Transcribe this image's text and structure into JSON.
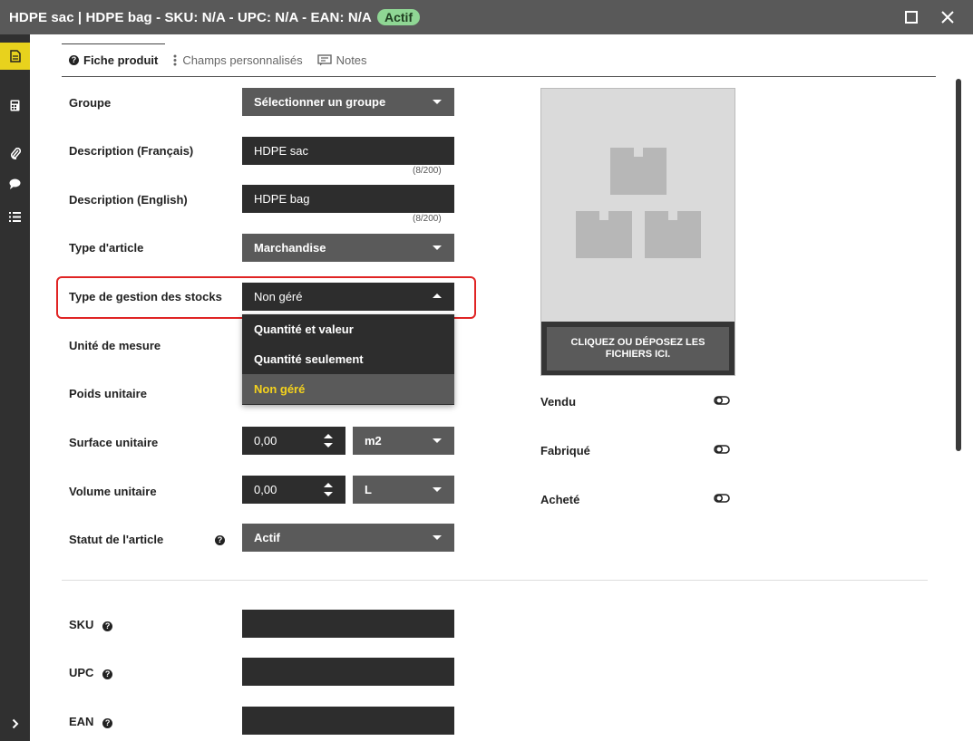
{
  "window": {
    "title": "HDPE sac | HDPE bag - SKU: N/A - UPC: N/A - EAN: N/A",
    "status_badge": "Actif"
  },
  "sidebar": {
    "items": [
      {
        "name": "document-icon",
        "active": true
      },
      {
        "name": "calculator-icon",
        "active": false
      },
      {
        "name": "paperclip-icon",
        "active": false
      },
      {
        "name": "comment-icon",
        "active": false
      },
      {
        "name": "list-icon",
        "active": false
      }
    ],
    "expand_icon": "chevron-right-icon"
  },
  "tabs": [
    {
      "label": "Fiche produit",
      "icon": "help-circle-icon",
      "active": true
    },
    {
      "label": "Champs personnalisés",
      "icon": "vertical-dots-icon",
      "active": false
    },
    {
      "label": "Notes",
      "icon": "notes-icon",
      "active": false
    }
  ],
  "form": {
    "groupe": {
      "label": "Groupe",
      "value": "Sélectionner un groupe"
    },
    "desc_fr": {
      "label": "Description (Français)",
      "value": "HDPE sac",
      "counter": "(8/200)"
    },
    "desc_en": {
      "label": "Description (English)",
      "value": "HDPE bag",
      "counter": "(8/200)"
    },
    "type_article": {
      "label": "Type d'article",
      "value": "Marchandise"
    },
    "type_gestion": {
      "label": "Type de gestion des stocks",
      "value": "Non géré",
      "options": [
        "Quantité et valeur",
        "Quantité seulement",
        "Non géré"
      ],
      "selected_option": "Non géré"
    },
    "unite_mesure": {
      "label": "Unité de mesure"
    },
    "poids_unitaire": {
      "label": "Poids unitaire"
    },
    "surface_unitaire": {
      "label": "Surface unitaire",
      "value": "0,00",
      "unit": "m2"
    },
    "volume_unitaire": {
      "label": "Volume unitaire",
      "value": "0,00",
      "unit": "L"
    },
    "statut": {
      "label": "Statut de l'article",
      "value": "Actif"
    },
    "sku": {
      "label": "SKU",
      "value": ""
    },
    "upc": {
      "label": "UPC",
      "value": ""
    },
    "ean": {
      "label": "EAN",
      "value": ""
    }
  },
  "image_zone": {
    "upload_label": "CLIQUEZ OU DÉPOSEZ LES FICHIERS ICI."
  },
  "toggles": [
    {
      "label": "Vendu",
      "on": false
    },
    {
      "label": "Fabriqué",
      "on": false
    },
    {
      "label": "Acheté",
      "on": false
    }
  ],
  "colors": {
    "title_bar": "#595959",
    "badge": "#8fd694",
    "sidebar": "#303030",
    "sidebar_active": "#e8d21d",
    "field_dark": "#2d2d2d",
    "field_select": "#5a5a5a",
    "selected_option_text": "#f5d31d",
    "highlight": "#e02424"
  }
}
